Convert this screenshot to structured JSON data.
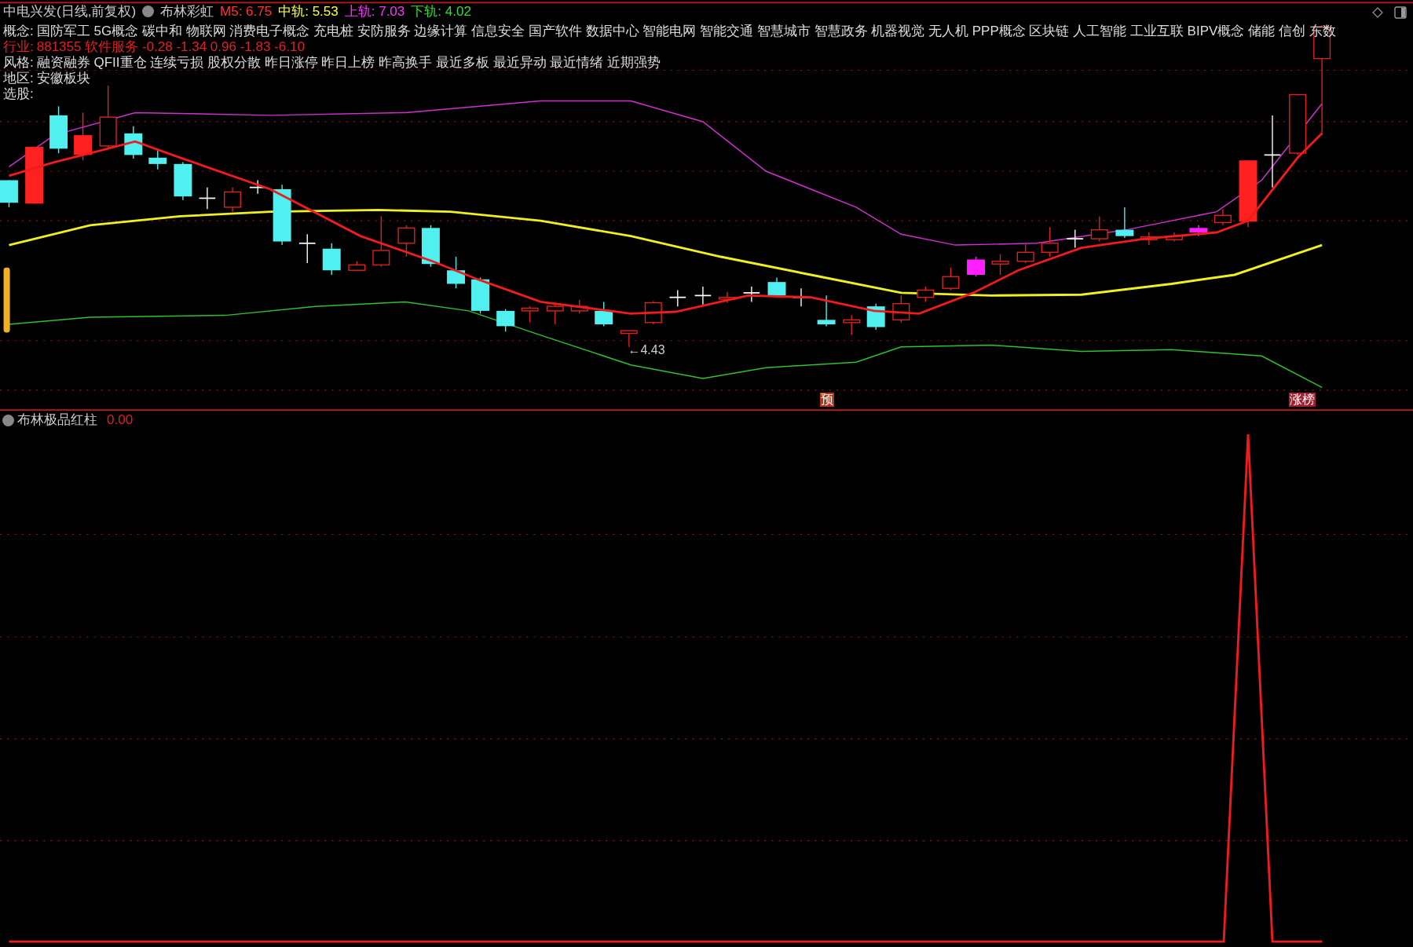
{
  "header": {
    "title": "中电兴发(日线,前复权)",
    "indicator": "布林彩虹",
    "readings": [
      {
        "label": "M5:",
        "value": "6.75",
        "color": "#ff3333"
      },
      {
        "label": "中轨:",
        "value": "5.53",
        "color": "#ffff33"
      },
      {
        "label": "上轨:",
        "value": "7.03",
        "color": "#ff33ff"
      },
      {
        "label": "下轨:",
        "value": "4.02",
        "color": "#33dd33"
      }
    ]
  },
  "info_rows": [
    {
      "label": "概念:",
      "text": "国防军工 5G概念 碳中和 物联网 消费电子概念 充电桩 安防服务 边缘计算 信息安全 国产软件 数据中心 智能电网 智能交通 智慧城市 智慧政务 机器视觉 无人机 PPP概念 区块链 人工智能 工业互联 BIPV概念 储能 信创 东数",
      "kind": "plain"
    },
    {
      "label": "行业:",
      "text": "881355 软件服务 -0.28 -1.34 0.96 -1.83 -6.10",
      "kind": "alert"
    },
    {
      "label": "风格:",
      "text": "融资融券 QFII重仓 连续亏损 股权分散 昨日涨停 昨日上榜 昨高换手 最近多板 最近异动 最近情绪 近期强势",
      "kind": "plain"
    },
    {
      "label": "地区:",
      "text": "安徽板块",
      "kind": "plain"
    },
    {
      "label": "选股:",
      "text": "",
      "kind": "plain"
    }
  ],
  "low_price_mark": "←4.43",
  "signal_tags": [
    {
      "text": "预"
    },
    {
      "text": "涨榜"
    }
  ],
  "lower_panel": {
    "indicator": "布林极品红柱",
    "reading": "0.00"
  }
}
